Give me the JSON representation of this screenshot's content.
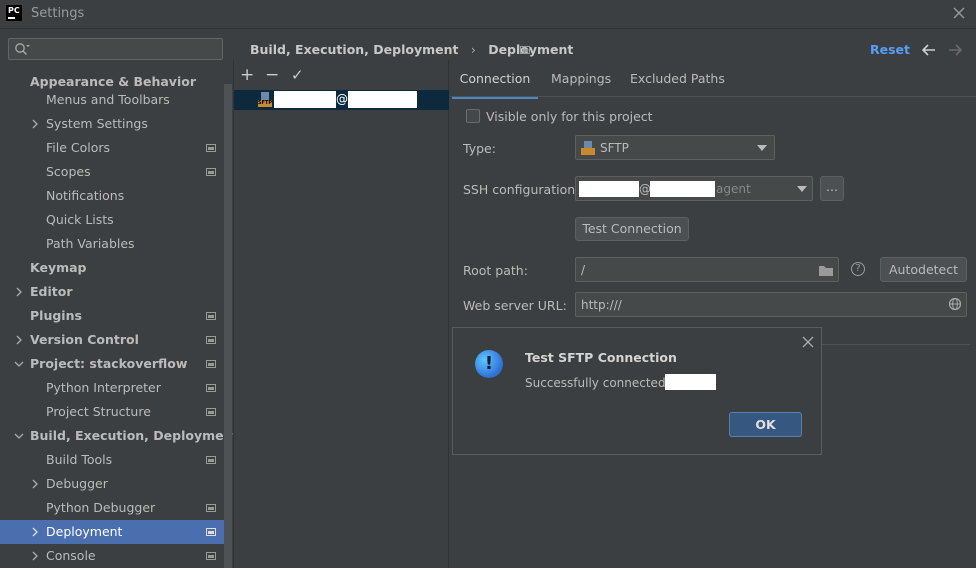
{
  "window": {
    "title": "Settings",
    "app_logo": "PC"
  },
  "search": {
    "placeholder": ""
  },
  "sidebar": {
    "items": [
      {
        "label": "Appearance & Behavior"
      },
      {
        "label": "Menus and Toolbars"
      },
      {
        "label": "System Settings"
      },
      {
        "label": "File Colors"
      },
      {
        "label": "Scopes"
      },
      {
        "label": "Notifications"
      },
      {
        "label": "Quick Lists"
      },
      {
        "label": "Path Variables"
      },
      {
        "label": "Keymap"
      },
      {
        "label": "Editor"
      },
      {
        "label": "Plugins"
      },
      {
        "label": "Version Control"
      },
      {
        "label": "Project: stackoverflow"
      },
      {
        "label": "Python Interpreter"
      },
      {
        "label": "Project Structure"
      },
      {
        "label": "Build, Execution, Deployment"
      },
      {
        "label": "Build Tools"
      },
      {
        "label": "Debugger"
      },
      {
        "label": "Python Debugger"
      },
      {
        "label": "Deployment"
      },
      {
        "label": "Console"
      }
    ]
  },
  "breadcrumb": {
    "parent": "Build, Execution, Deployment",
    "separator": "›",
    "current": "Deployment"
  },
  "header": {
    "reset_label": "Reset"
  },
  "server_list": {
    "add": "+",
    "remove": "−",
    "apply": "✓",
    "server_at": "@",
    "server_icon_text": "SFTP"
  },
  "tabs": [
    {
      "label": "Connection"
    },
    {
      "label": "Mappings"
    },
    {
      "label": "Excluded Paths"
    }
  ],
  "form": {
    "visible_only_label": "Visible only for this project",
    "type_label": "Type:",
    "type_value": "SFTP",
    "ssh_label": "SSH configuration:",
    "ssh_at": "@",
    "ssh_suffix": "agent",
    "ssh_more": "...",
    "test_connection_label": "Test Connection",
    "root_path_label": "Root path:",
    "root_path_value": "/",
    "help_glyph": "?",
    "autodetect_label": "Autodetect",
    "web_url_label": "Web server URL:",
    "web_url_value": "http:///"
  },
  "dialog": {
    "title": "Test SFTP Connection",
    "message": "Successfully connected to",
    "ok_label": "OK",
    "info_glyph": "!"
  },
  "colors": {
    "accent": "#4a88c7",
    "selection": "#4b6eaf",
    "background": "#3c3f41"
  }
}
